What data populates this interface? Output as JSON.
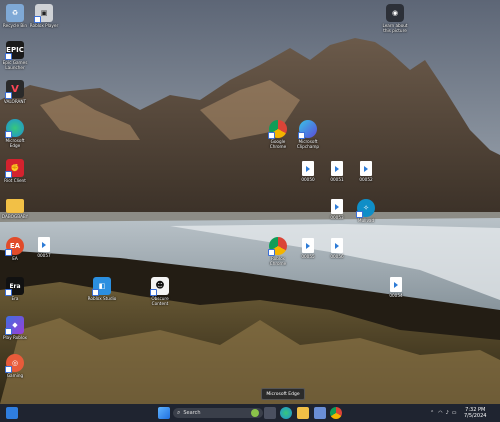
{
  "desktop_icons": [
    {
      "label": "Recycle Bin",
      "icon": "recycle-bin-icon",
      "color": "#7fa9d6"
    },
    {
      "label": "Roblox Player",
      "icon": "roblox-icon",
      "color": "#cfd2d6"
    },
    {
      "label": "Epic Games Launcher",
      "icon": "epic-games-icon",
      "color": "#1b1b1b"
    },
    {
      "label": "VALORANT",
      "icon": "valorant-icon",
      "color": "#2a2a2a"
    },
    {
      "label": "Microsoft Edge",
      "icon": "edge-icon",
      "color": "#1e8fd8"
    },
    {
      "label": "Riot Client",
      "icon": "riot-icon",
      "color": "#d4222e"
    },
    {
      "label": "DABOGBABY",
      "icon": "folder-icon",
      "color": "#f2c046"
    },
    {
      "label": "EA",
      "icon": "ea-icon",
      "color": "#e14b2a"
    },
    {
      "label": "Era",
      "icon": "era-icon",
      "color": "#111"
    },
    {
      "label": "Play Roblox",
      "icon": "play-roblox-icon",
      "color": "#6a3fd6"
    },
    {
      "label": "Gaming",
      "icon": "gaming-icon",
      "color": "#e85b3a"
    },
    {
      "label": "Learn about this picture",
      "icon": "camera-icon",
      "color": "#2c3038"
    },
    {
      "label": "Google Chrome",
      "icon": "chrome-icon",
      "color": "#2f9a4b"
    },
    {
      "label": "Microsoft Clipchamp",
      "icon": "clipchamp-icon",
      "color": "#5b4ad9"
    },
    {
      "label": "00050",
      "icon": "file-icon",
      "color": "#fff"
    },
    {
      "label": "00051",
      "icon": "file-icon",
      "color": "#fff"
    },
    {
      "label": "00052",
      "icon": "file-icon",
      "color": "#fff"
    },
    {
      "label": "00053",
      "icon": "file-icon",
      "color": "#fff"
    },
    {
      "label": "Mullvad",
      "icon": "mullvad-icon",
      "color": "#0f8ec7"
    },
    {
      "label": "Roblox Chrome",
      "icon": "chrome-icon",
      "color": "#2f9a4b"
    },
    {
      "label": "00055",
      "icon": "file-icon",
      "color": "#fff"
    },
    {
      "label": "00056",
      "icon": "file-icon",
      "color": "#fff"
    },
    {
      "label": "00054",
      "icon": "file-icon",
      "color": "#fff"
    },
    {
      "label": "Roblox Studio",
      "icon": "roblox-studio-icon",
      "color": "#2b8fe0"
    },
    {
      "label": "Obscure Content",
      "icon": "panda-icon",
      "color": "#111"
    },
    {
      "label": "00057",
      "icon": "file-icon",
      "color": "#fff"
    }
  ],
  "tooltip": "Microsoft Edge",
  "taskbar": {
    "search_placeholder": "Search",
    "time": "7:32 PM",
    "date": "7/5/2024"
  }
}
